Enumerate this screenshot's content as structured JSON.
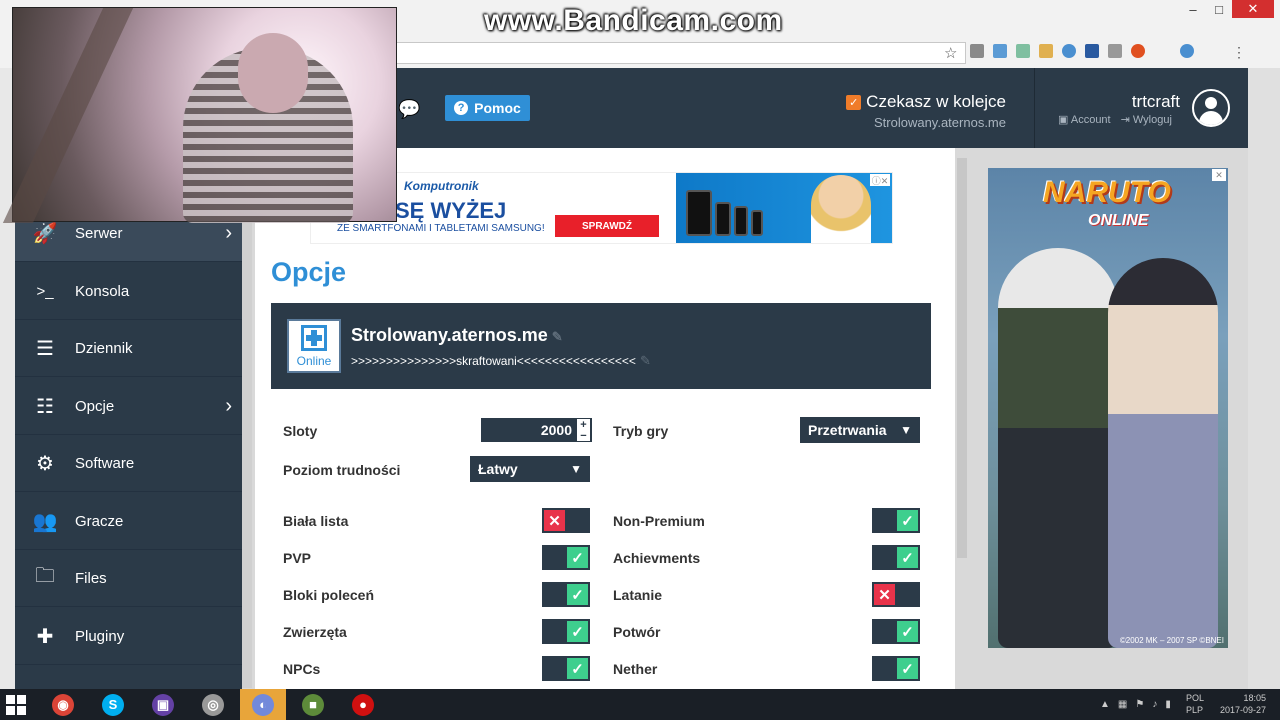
{
  "watermark": "www.Bandicam.com",
  "window_controls": {
    "minimize": "–",
    "maximize": "□",
    "close": "✕"
  },
  "header": {
    "help_label": "Pomoc",
    "queue_title": "Czekasz w kolejce",
    "queue_server": "Strolowany.aternos.me",
    "username": "trtcraft",
    "account_label": "Account",
    "logout_label": "Wyloguj"
  },
  "sidebar": {
    "items": [
      {
        "label": "Serwer",
        "icon": "rocket-icon",
        "arrow": true
      },
      {
        "label": "Konsola",
        "icon": "terminal-icon",
        "arrow": false
      },
      {
        "label": "Dziennik",
        "icon": "log-icon",
        "arrow": false
      },
      {
        "label": "Opcje",
        "icon": "sliders-icon",
        "arrow": true
      },
      {
        "label": "Software",
        "icon": "gears-icon",
        "arrow": false
      },
      {
        "label": "Gracze",
        "icon": "users-icon",
        "arrow": false
      },
      {
        "label": "Files",
        "icon": "folder-icon",
        "arrow": false
      },
      {
        "label": "Pluginy",
        "icon": "puzzle-icon",
        "arrow": false
      }
    ]
  },
  "ad_banner": {
    "brand": "Komputronik",
    "headline": "SĘ WYŻEJ",
    "sub": "ZE SMARTFONAMI I TABLETAMI SAMSUNG!",
    "cta": "SPRAWDŹ"
  },
  "main": {
    "title": "Opcje",
    "server_status": "Online",
    "server_name": "Strolowany.aternos.me",
    "server_motd": ">>>>>>>>>>>>>>>skraftowani<<<<<<<<<<<<<<<<<"
  },
  "options": {
    "slots_label": "Sloty",
    "slots_value": "2000",
    "gamemode_label": "Tryb gry",
    "gamemode_value": "Przetrwania",
    "difficulty_label": "Poziom trudności",
    "difficulty_value": "Łatwy",
    "toggles_left": [
      {
        "label": "Biała lista",
        "on": false
      },
      {
        "label": "PVP",
        "on": true
      },
      {
        "label": "Bloki poleceń",
        "on": true
      },
      {
        "label": "Zwierzęta",
        "on": true
      },
      {
        "label": "NPCs",
        "on": true
      }
    ],
    "toggles_right": [
      {
        "label": "Non-Premium",
        "on": true
      },
      {
        "label": "Achievments",
        "on": true
      },
      {
        "label": "Latanie",
        "on": false
      },
      {
        "label": "Potwór",
        "on": true
      },
      {
        "label": "Nether",
        "on": true
      }
    ]
  },
  "side_ad": {
    "title": "NARUTO",
    "subtitle": "ONLINE",
    "copyright": "©2002 MK – 2007 SP ©BNEI"
  },
  "taskbar": {
    "apps": [
      "chrome-icon",
      "skype-icon",
      "twitch-icon",
      "disc-icon",
      "discord-icon",
      "minecraft-icon",
      "bandicam-icon"
    ],
    "lang_top": "POL",
    "lang_bottom": "PLP",
    "time": "18:05",
    "date": "2017-09-27"
  },
  "colors": {
    "accent": "#2f8fd6",
    "dark": "#2b3a48",
    "toggle_on": "#3ecf8e",
    "toggle_off": "#e8334a",
    "queue_check": "#f07c2a"
  }
}
